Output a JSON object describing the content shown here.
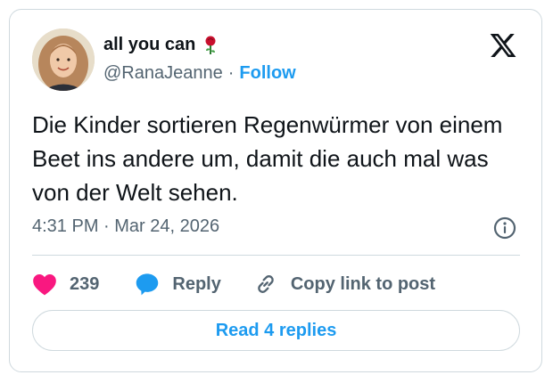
{
  "author": {
    "display_name": "all you can",
    "name_emoji": "rose-icon",
    "handle": "@RanaJeanne",
    "separator": "·",
    "follow_label": "Follow"
  },
  "tweet": {
    "text": "Die Kinder sortieren Regenwürmer von einem Beet ins andere um, damit die auch mal was von der Welt sehen.",
    "timestamp": "4:31 PM · Mar 24, 2026"
  },
  "actions": {
    "like_count": "239",
    "reply_label": "Reply",
    "copy_label": "Copy link to post"
  },
  "read_replies_label": "Read 4 replies",
  "colors": {
    "accent": "#1d9bf0",
    "like": "#f91880",
    "muted": "#536471",
    "text": "#0f1419",
    "border": "#cfd9de"
  }
}
